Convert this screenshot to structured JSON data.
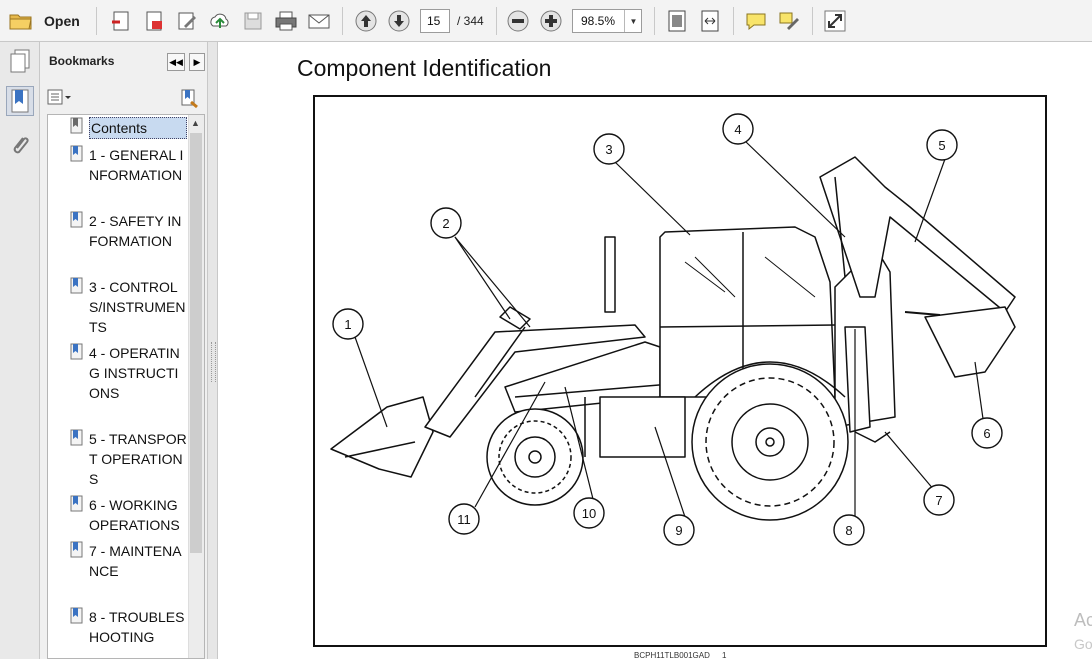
{
  "toolbar": {
    "open_label": "Open",
    "page_current": "15",
    "page_total": "/ 344",
    "zoom": "98.5%"
  },
  "sidebar": {
    "title": "Bookmarks",
    "items": [
      {
        "label": "Contents"
      },
      {
        "label": "1 - GENERAL INFORMATION"
      },
      {
        "label": "2 - SAFETY INFORMATION"
      },
      {
        "label": "3 - CONTROLS/INSTRUMENTS"
      },
      {
        "label": "4 - OPERATING INSTRUCTIONS"
      },
      {
        "label": "5 - TRANSPORT OPERATIONS"
      },
      {
        "label": "6 - WORKING OPERATIONS"
      },
      {
        "label": "7 - MAINTENANCE"
      },
      {
        "label": "8 - TROUBLESHOOTING"
      }
    ]
  },
  "document": {
    "title": "Component Identification",
    "callouts": [
      "1",
      "2",
      "3",
      "4",
      "5",
      "6",
      "7",
      "8",
      "9",
      "10",
      "11"
    ],
    "figure_code": "BCPH11TLB001GAD",
    "figure_number": "1"
  },
  "watermark": {
    "line1": "Ac",
    "line2": "Go"
  },
  "colors": {
    "accent": "#2f6fb5",
    "selection": "#c8daf0"
  }
}
